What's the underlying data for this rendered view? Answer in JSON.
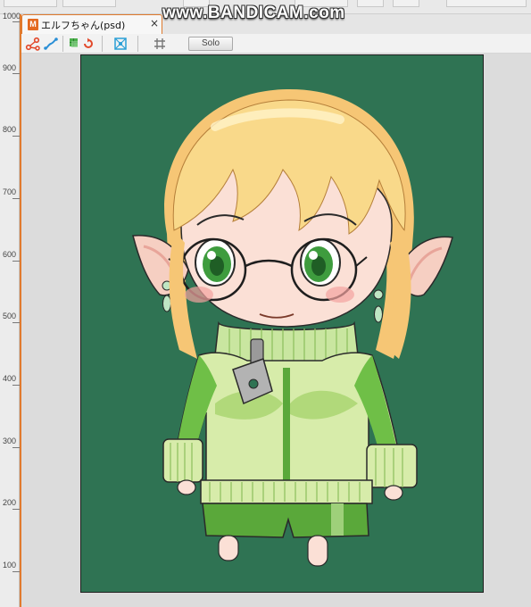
{
  "document_tab": {
    "badge": "M",
    "title": "エルフちゃん(psd)",
    "close_glyph": "×"
  },
  "watermark": "www.BANDICAM.com",
  "toolbar": {
    "solo_label": "Solo",
    "icons": [
      "bone-icon",
      "link-icon",
      "mesh-icon",
      "loop-icon",
      "warp-icon",
      "grid-icon"
    ]
  },
  "ruler": {
    "labels": [
      "1000",
      "900",
      "800",
      "700",
      "600",
      "500",
      "400",
      "300",
      "200",
      "100"
    ]
  },
  "colors": {
    "accent": "#e07a2e",
    "canvas_bg": "#2f7353"
  }
}
